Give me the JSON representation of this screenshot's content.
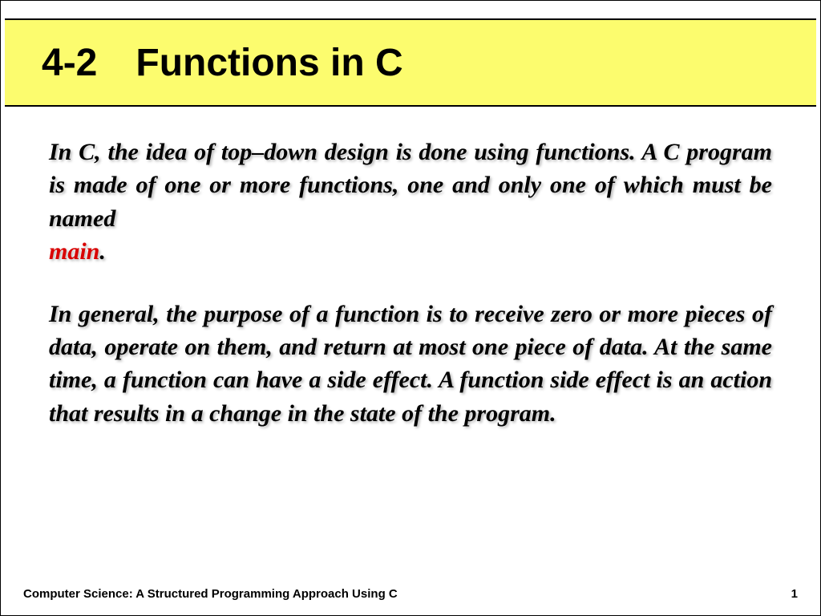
{
  "title": "4-2 Functions in C",
  "para1": "In C, the idea of top–down design is done using functions. A C program is made of one or more functions, one and only one of which must be named",
  "main_keyword": "main",
  "para1_end": ".",
  "para2": "In general, the purpose of a function is to receive zero or more pieces of data, operate on them, and return at most one piece of data. At the same time, a function can have a side effect. A function side effect is an action that results in a change in the state of the program.",
  "footer_left": "Computer Science: A Structured Programming Approach Using C",
  "footer_right": "1"
}
